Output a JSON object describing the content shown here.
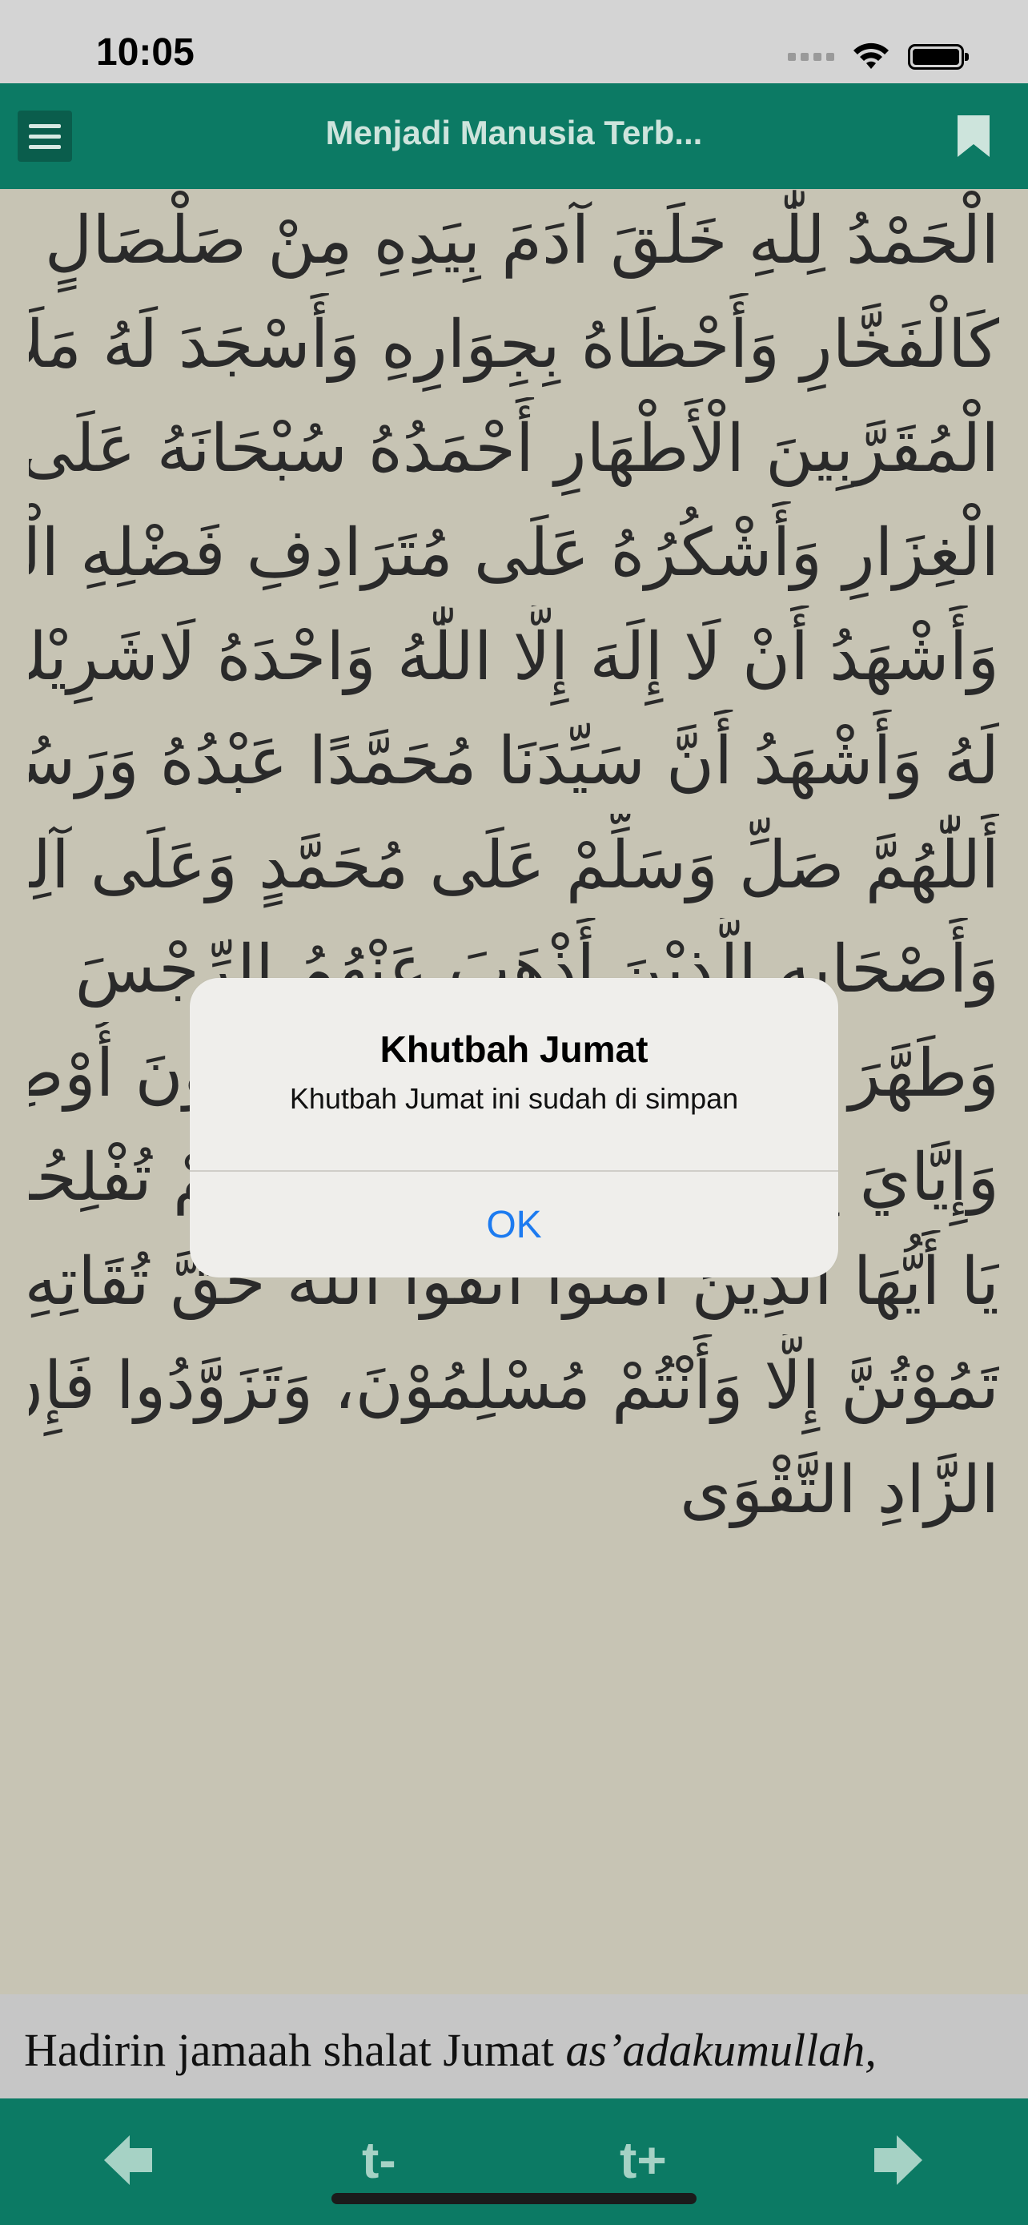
{
  "status_bar": {
    "time": "10:05"
  },
  "navbar": {
    "title": "Menjadi Manusia Terb..."
  },
  "arabic_lines": [
    "الْحَمْدُ لِلّٰهِ خَلَقَ آدَمَ بِيَدِهِ مِنْ صَلْصَالٍ",
    "كَالْفَخَّارِ وَأَحْظَاهُ بِجِوَارِهِ وَأَسْجَدَ لَهُ مَلَائِكَةُ",
    "الْمُقَرَّبِينَ الْأَطْهَارِ أَحْمَدُهُ سُبْحَانَهُ عَلَى نِعَمِ",
    "الْغِزَارِ وَأَشْكُرُهُ عَلَى مُتَرَادِفِ فَضْلِهِ الْمِدْرَارِ",
    "وَأَشْهَدُ أَنْ لَا إِلَهَ إِلَّا اللّٰهُ وَاحْدَهُ لَاشَرِيْكَ",
    "لَهُ وَأَشْهَدُ أَنَّ سَيِّدَنَا مُحَمَّدًا عَبْدُهُ وَرَسُوْلُهُ",
    "أَللّٰهُمَّ صَلِّ وَسَلِّمْ عَلَى مُحَمَّدٍ وَعَلَى آلِهِ",
    "وَأَصْحَابِهِ الَّذِيْنَ أَذْهَبَ عَنْهُمُ الرِّجْسَ",
    "وَطَهَّرَ أَمَّا بَعْدُ، فَيَا أَيُّهَا الْحَاضِرُوْنَ أُوْصِيْكُمْ",
    "وَإِيَّايَ بِتَقْوَى اللّٰهِ وَطَاعَتِهِ لَعَلَّكُمْ تُفْلِحُوْنَ.",
    "يَا أَيُّهَا الَّذِيْنَ آمَنُوا اتَّقُوا اللّٰهَ حَقَّ تُقَاتِهِ وَلَا",
    "تَمُوْتُنَّ إِلَّا وَأَنْتُمْ مُسْلِمُوْنَ، وَتَزَوَّدُوا فَإِنَّ خَيْرَ",
    "الزَّادِ التَّقْوَى"
  ],
  "translation": {
    "text": "Hadirin jamaah shalat Jumat ",
    "italic": "as’adakumullah,"
  },
  "toolbar": {
    "font_smaller": "t-",
    "font_larger": "t+"
  },
  "alert": {
    "title": "Khutbah Jumat",
    "message": "Khutbah Jumat ini sudah di simpan",
    "ok_label": "OK"
  },
  "colors": {
    "primary": "#0c7a64",
    "page_bg": "#c7c4b4",
    "alert_button": "#1d7bf0"
  }
}
